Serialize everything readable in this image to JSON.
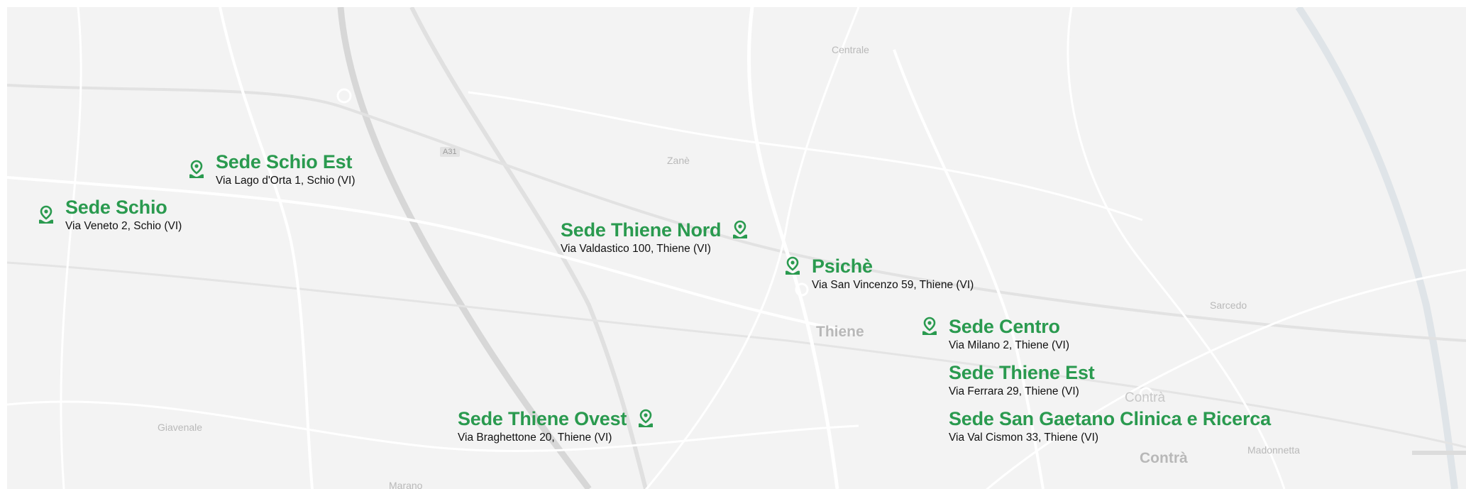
{
  "map": {
    "place_labels": {
      "centrale": "Centrale",
      "zane": "Zanè",
      "thiene": "Thiene",
      "sarcedo": "Sarcedo",
      "giavenale": "Giavenale",
      "marano": "Marano",
      "contra_small": "Contrà",
      "contra_big": "Contrà",
      "madonnetta": "Madonnetta",
      "road_shield": "A31"
    }
  },
  "locations": [
    {
      "name": "Sede Schio Est",
      "address": "Via Lago d'Orta 1, Schio (VI)"
    },
    {
      "name": "Sede Schio",
      "address": "Via Veneto 2, Schio (VI)"
    },
    {
      "name": "Sede Thiene Nord",
      "address": "Via Valdastico 100, Thiene (VI)"
    },
    {
      "name": "Psichè",
      "address": "Via San Vincenzo 59, Thiene (VI)"
    },
    {
      "name": "Sede Centro",
      "address": "Via Milano 2, Thiene (VI)"
    },
    {
      "name": "Sede Thiene Est",
      "address": "Via Ferrara 29, Thiene (VI)"
    },
    {
      "name": "Sede San Gaetano Clinica e Ricerca",
      "address": "Via Val Cismon 33, Thiene (VI)"
    },
    {
      "name": "Sede Thiene Ovest",
      "address": "Via Braghettone 20, Thiene (VI)"
    }
  ],
  "colors": {
    "accent": "#2a9a4f",
    "map_bg": "#f3f3f3"
  },
  "icons": {
    "marker": "map-pin-icon"
  }
}
